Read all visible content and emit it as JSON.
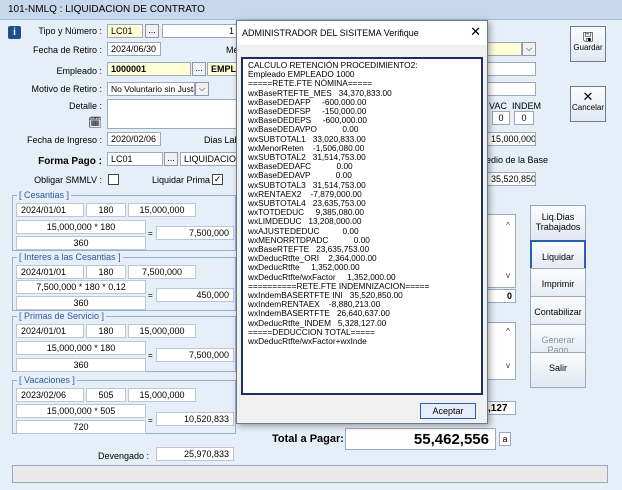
{
  "window_title": "101-NMLQ : LIQUIDACION DE CONTRATO",
  "form": {
    "tipo_numero_label": "Tipo y Número :",
    "tipo_value": "LC01",
    "numero_value": "1",
    "fecha_retiro_label": "Fecha de Retiro :",
    "fecha_retiro_value": "2024/06/30",
    "mes_label_partial": "Mé",
    "empleado_label": "Empleado :",
    "empleado_code": "1000001",
    "empleado_name_partial": "EMPLE",
    "motivo_label": "Motivo de Retiro :",
    "motivo_value": "No Voluntario sin Justa",
    "detalle_label": "Detalle :",
    "fecha_ingreso_label": "Fecha de Ingreso :",
    "fecha_ingreso_value": "2020/02/06",
    "dias_lab_label": "Dias Lab",
    "forma_pago_label": "Forma Pago :",
    "forma_pago_code": "LC01",
    "forma_pago_name": "LIQUIDACION",
    "obligar_smmlv_label": "Obligar SMMLV :",
    "obligar_smmlv_checked": false,
    "liquidar_prima_label": "Liquidar Prima :",
    "liquidar_prima_checked": true,
    "vac_label": "VAC",
    "indem_label": "INDEM",
    "vac_value": "0",
    "indem_value": "0",
    "salary_value": "15,000,000",
    "promedio_base_label": "edio de la Base",
    "promedio_base_value": "35,520,850"
  },
  "cesantias": {
    "title": "[ Cesantias ]",
    "fecha": "2024/01/01",
    "dias": "180",
    "base": "15,000,000",
    "formula": "15,000,000 * 180",
    "divisor": "360",
    "result": "7,500,000"
  },
  "intereses": {
    "title": "[ Interes a las Cesantias ]",
    "fecha": "2024/01/01",
    "dias": "180",
    "base": "7,500,000",
    "formula": "7,500,000 * 180 * 0.12",
    "divisor": "360",
    "result": "450,000"
  },
  "primas": {
    "title": "[ Primas de Servicio ]",
    "fecha": "2024/01/01",
    "dias": "180",
    "base": "15,000,000",
    "formula": "15,000,000 * 180",
    "divisor": "360",
    "result": "7,500,000"
  },
  "vacaciones": {
    "title": "[ Vacaciones ]",
    "fecha": "2023/02/06",
    "dias": "505",
    "base": "15,000,000",
    "formula": "15,000,000 * 505",
    "divisor": "720",
    "result": "10,520,833"
  },
  "devengado_label": "Devengado :",
  "devengado_value": "25,970,833",
  "right_partial_zero": "0",
  "right_partial_127": ",127",
  "total_label": "Total a Pagar:",
  "total_value": "55,462,556",
  "total_suffix": "a",
  "buttons": {
    "guardar": "Guardar",
    "cancelar": "Cancelar",
    "liq_dias": "Liq.Dias Trabajados",
    "liquidar": "Liquidar",
    "imprimir": "Imprimir",
    "contabilizar": "Contabilizar",
    "generar_pago": "Generar Pago",
    "salir": "Salir"
  },
  "dialog": {
    "title": "ADMINISTRADOR DEL SISITEMA Verifique",
    "close": "✕",
    "ok": "Aceptar",
    "lines": [
      "CALCULO RETENCIÓN PROCEDIMIENTO2:",
      "Empleado EMPLEADO 1000",
      "=====RETE.FTE NÓMINA=====",
      "wxBaseRTEFTE_MES   34,370,833.00",
      "wxBaseDEDAFP     -600,000.00",
      "wxBaseDEDFSP     -150,000.00",
      "wxBaseDEDEPS     -600,000.00",
      "wxBaseDEDAVPO           0.00",
      "wxSUBTOTAL1   33,020,833.00",
      "wxMenorReten    -1,506,080.00",
      "wxSUBTOTAL2   31,514,753.00",
      "wxBaseDEDAFC           0.00",
      "wxBaseDEDAVP           0.00",
      "wxSUBTOTAL3   31,514,753.00",
      "wxRENTAEX2    -7,879,000.00",
      "wxSUBTOTAL4   23,635,753.00",
      "wxTOTDEDUC     9,385,080.00",
      "wxLIMDEDUC   13,208,000.00",
      "wxAJUSTEDEDUC          0.00",
      "wxMENORRTDPADC           0.00",
      "wxBaseRTEFTE   23,635,753.00",
      "wxDeducRtfte_ORI    2,364,000.00",
      "wxDeducRtfte     1,352,000.00",
      "wxDeducRtfte/wxFactor     1,352,000.00",
      "==========RETE.FTE INDEMNIZACION=====",
      "wxIndemBASERTFTE INI   35,520,850.00",
      "wxIndemRENTAEX    -8,880,213.00",
      "wxIndemBASERTFTE   26,640,637.00",
      "wxDeducRtfte_INDEM   5,328,127.00",
      "=====DEDUCCION TOTAL=====",
      "wxDeducRtfte/wxFactor+wxInde"
    ]
  }
}
